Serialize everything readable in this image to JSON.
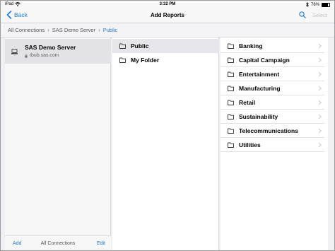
{
  "status_bar": {
    "carrier": "iPad",
    "time": "3:32 PM",
    "battery": "76%",
    "battery_level": 0.76
  },
  "nav": {
    "back_label": "Back",
    "title": "Add Reports",
    "select_label": "Select"
  },
  "breadcrumb": [
    "All Connections",
    "SAS Demo Server",
    "Public"
  ],
  "connections": {
    "server_name": "SAS Demo Server",
    "server_host": "tbub.sas.com",
    "footer": {
      "add_label": "Add",
      "title": "All Connections",
      "edit_label": "Edit"
    }
  },
  "folders": [
    {
      "label": "Public",
      "selected": true
    },
    {
      "label": "My Folder",
      "selected": false
    }
  ],
  "subfolders": [
    "Banking",
    "Capital Campaign",
    "Entertainment",
    "Manufacturing",
    "Retail",
    "Sustainability",
    "Telecommunications",
    "Utilities"
  ],
  "colors": {
    "accent": "#1b7bd9",
    "selected_row": "#e6e6ea"
  },
  "icons": [
    "wifi-icon",
    "bluetooth-icon",
    "battery-icon",
    "back-chevron-icon",
    "search-icon",
    "server-icon",
    "lock-icon",
    "folder-icon",
    "chevron-right-icon"
  ]
}
